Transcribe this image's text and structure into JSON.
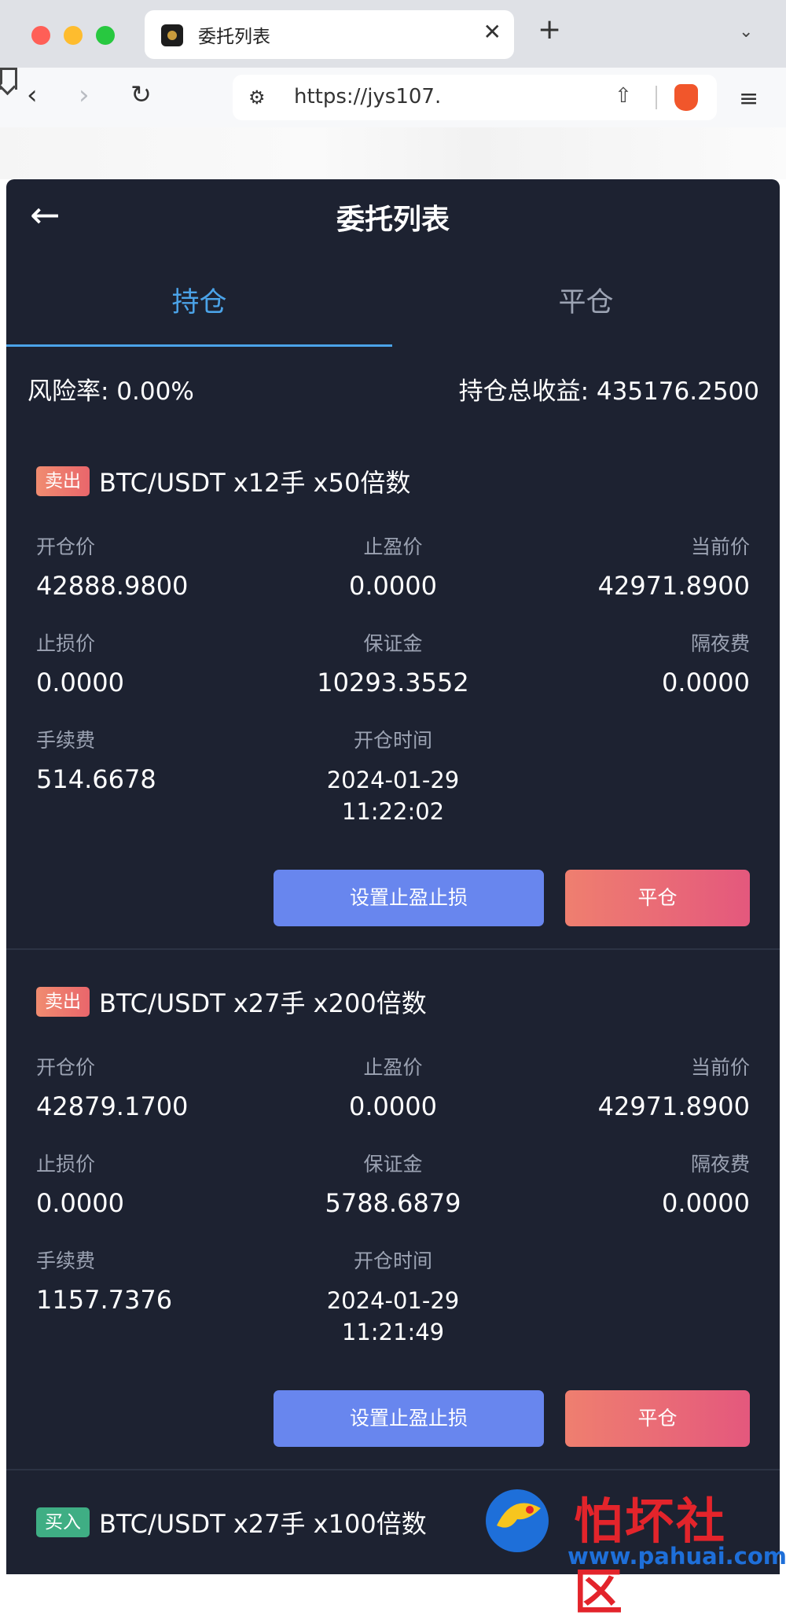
{
  "browser": {
    "tab_title": "委托列表",
    "tab_close": "✕",
    "new_tab": "+",
    "tab_list": "⌄",
    "url": "https://jys107.",
    "icons": [
      "back-icon",
      "forward-icon",
      "reload-icon",
      "bookmark-icon",
      "site-settings-icon",
      "share-icon",
      "brave-shield-icon",
      "menu-icon"
    ]
  },
  "header": {
    "back": "←",
    "title": "委托列表"
  },
  "tabs": {
    "holding": "持仓",
    "closed": "平仓"
  },
  "summary": {
    "risk_rate": "风险率: 0.00%",
    "total_profit": "持仓总收益: 435176.2500"
  },
  "labels": {
    "open_price": "开仓价",
    "take_profit": "止盈价",
    "current_price": "当前价",
    "stop_loss": "止损价",
    "margin": "保证金",
    "overnight_fee": "隔夜费",
    "fee": "手续费",
    "open_time": "开仓时间",
    "set_tp_sl": "设置止盈止损",
    "close_position": "平仓"
  },
  "orders": [
    {
      "side": "卖出",
      "symbol": "BTC/USDT x12手 x50倍数",
      "open_price": "42888.9800",
      "take_profit": "0.0000",
      "current_price": "42971.8900",
      "stop_loss": "0.0000",
      "margin": "10293.3552",
      "overnight_fee": "0.0000",
      "fee": "514.6678",
      "open_date": "2024-01-29",
      "open_clock": "11:22:02"
    },
    {
      "side": "卖出",
      "symbol": "BTC/USDT x27手 x200倍数",
      "open_price": "42879.1700",
      "take_profit": "0.0000",
      "current_price": "42971.8900",
      "stop_loss": "0.0000",
      "margin": "5788.6879",
      "overnight_fee": "0.0000",
      "fee": "1157.7376",
      "open_date": "2024-01-29",
      "open_clock": "11:21:49"
    },
    {
      "side": "买入",
      "symbol": "BTC/USDT x27手 x100倍数"
    }
  ],
  "watermark": {
    "name": "怕坏社区",
    "url": "www.pahuai.com"
  },
  "colors": {
    "app_bg": "#1d2231",
    "accent": "#4ba3e8",
    "sell": "#e9666b",
    "buy": "#3fae84",
    "primary_button": "#6886ee"
  }
}
